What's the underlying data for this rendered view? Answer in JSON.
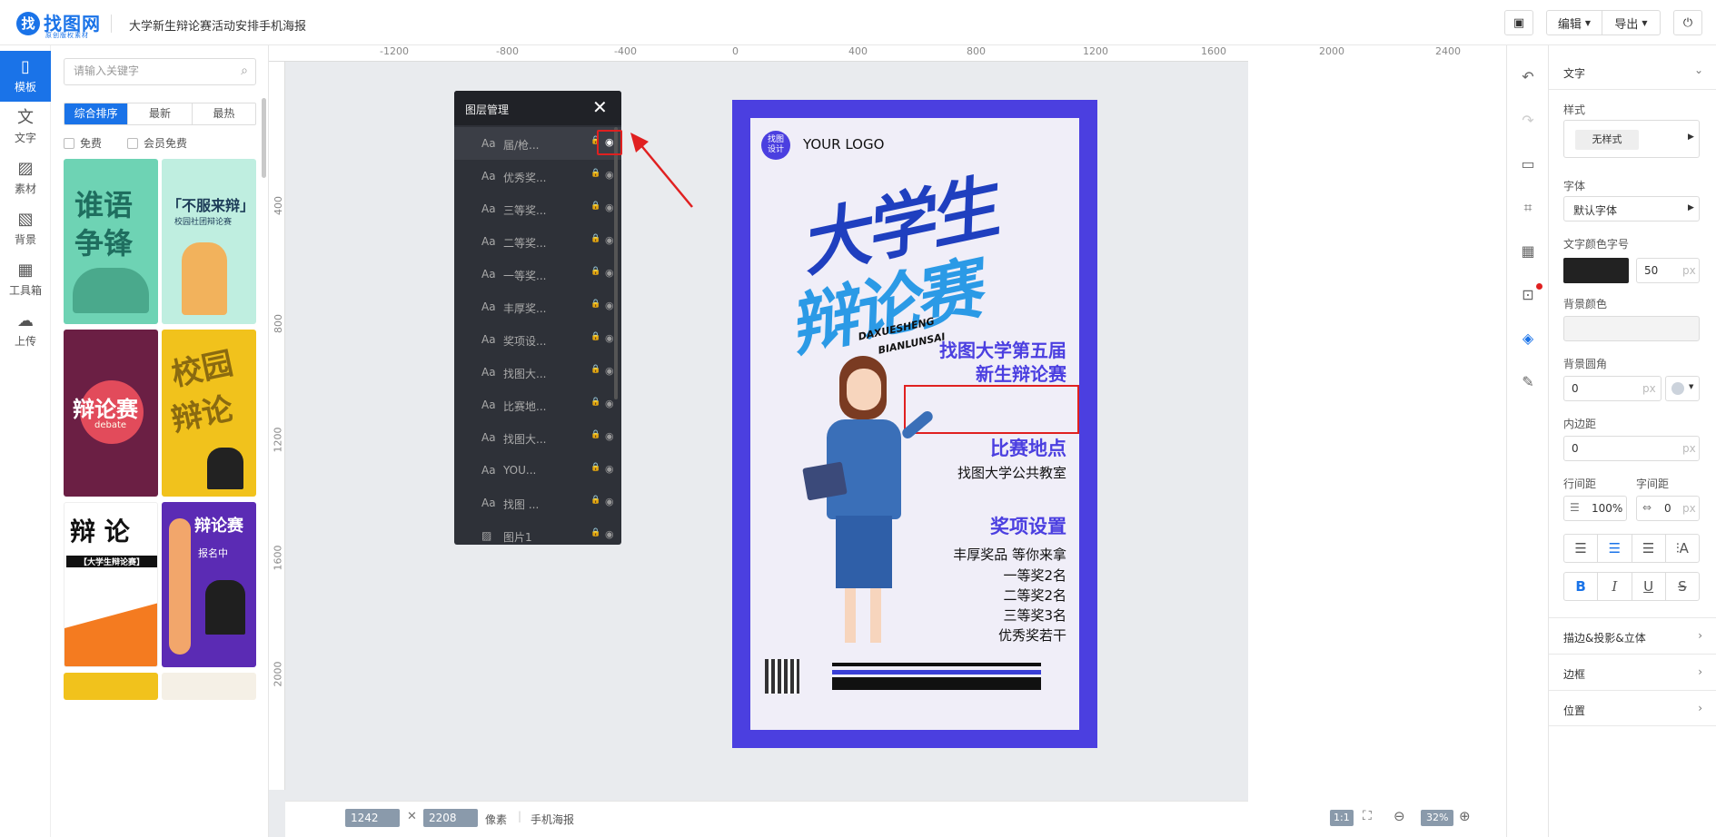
{
  "header": {
    "logo_mark": "找",
    "logo_text": "找图网",
    "logo_sub": "原创版权素材",
    "doc_title": "大学新生辩论赛活动安排手机海报",
    "edit_label": "编辑",
    "export_label": "导出"
  },
  "left_nav": [
    {
      "label": "模板",
      "icon": "template-icon"
    },
    {
      "label": "文字",
      "icon": "text-icon"
    },
    {
      "label": "素材",
      "icon": "image-icon"
    },
    {
      "label": "背景",
      "icon": "background-icon"
    },
    {
      "label": "工具箱",
      "icon": "toolbox-icon"
    },
    {
      "label": "上传",
      "icon": "upload-icon"
    }
  ],
  "panel": {
    "search_placeholder": "请输入关键字",
    "sort_tabs": [
      "综合排序",
      "最新",
      "最热"
    ],
    "filters": [
      "免费",
      "会员免费"
    ],
    "thumbs": [
      {
        "line1": "谁语",
        "line2": "争锋"
      },
      {
        "line1": "「不服来辩」",
        "line2": "校园社团辩论赛"
      },
      {
        "line1": "辩论赛",
        "line2": "debate"
      },
      {
        "line1": "校园",
        "line2": "辩论"
      },
      {
        "line1": "辩 论",
        "line2": "【大学生辩论赛】"
      },
      {
        "line1": "辩论赛",
        "line2": "报名中"
      }
    ]
  },
  "rulers": {
    "top": [
      "-1200",
      "-800",
      "-400",
      "0",
      "400",
      "800",
      "1200",
      "1600",
      "2000",
      "2400"
    ],
    "left": [
      "400",
      "800",
      "1200",
      "1600",
      "2000"
    ]
  },
  "bottom": {
    "width": "1242",
    "height": "2208",
    "unit": "像素",
    "preset": "手机海报",
    "ratio": "1:1",
    "zoom": "32%"
  },
  "layers": {
    "title": "图层管理",
    "items": [
      {
        "type": "Aa",
        "name": "届/枪..."
      },
      {
        "type": "Aa",
        "name": "优秀奖..."
      },
      {
        "type": "Aa",
        "name": "三等奖..."
      },
      {
        "type": "Aa",
        "name": "二等奖..."
      },
      {
        "type": "Aa",
        "name": "一等奖..."
      },
      {
        "type": "Aa",
        "name": "丰厚奖..."
      },
      {
        "type": "Aa",
        "name": "奖项设..."
      },
      {
        "type": "Aa",
        "name": "找图大..."
      },
      {
        "type": "Aa",
        "name": "比赛地..."
      },
      {
        "type": "Aa",
        "name": "找图大..."
      },
      {
        "type": "Aa",
        "name": "YOU..."
      },
      {
        "type": "Aa",
        "name": "找图 ..."
      },
      {
        "type": "img",
        "name": "图片1"
      }
    ]
  },
  "poster": {
    "logo_badge": "找图\n设计",
    "logo_text": "YOUR LOGO",
    "title1": "大学生",
    "title2": "辩论赛",
    "pinyin1": "DAXUESHENG",
    "pinyin2": "BIANLUNSAI",
    "subtitle1": "找图大学第五届",
    "subtitle2": "新生辩论赛",
    "venue_title": "比赛地点",
    "venue": "找图大学公共教室",
    "awards_title": "奖项设置",
    "awards": [
      "丰厚奖品 等你来拿",
      "一等奖2名",
      "二等奖2名",
      "三等奖3名",
      "优秀奖若干"
    ]
  },
  "props": {
    "section_text": "文字",
    "style_label": "样式",
    "style_value": "无样式",
    "font_label": "字体",
    "font_value": "默认字体",
    "color_size_label": "文字颜色字号",
    "font_size": "50",
    "px": "px",
    "bg_color_label": "背景颜色",
    "bg_radius_label": "背景圆角",
    "radius_value": "0",
    "padding_label": "内边距",
    "padding_value": "0",
    "line_height_label": "行间距",
    "letter_spacing_label": "字间距",
    "line_height_value": "100%",
    "letter_spacing_value": "0",
    "sections": [
      "描边&投影&立体",
      "边框",
      "位置"
    ],
    "text_color": "#222222"
  }
}
